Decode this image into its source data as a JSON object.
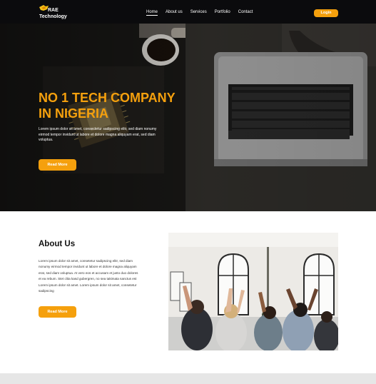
{
  "brand": {
    "line1": "RAE",
    "line2": "Technology"
  },
  "nav": {
    "links": [
      "Home",
      "About us",
      "Services",
      "Portfolio",
      "Contact"
    ],
    "active_index": 0,
    "login_label": "Login"
  },
  "hero": {
    "title_line1": "NO 1 TECH COMPANY",
    "title_line2": "IN NIGERIA",
    "text": "Lorem ipsum dolor sit amet, consectetur sadipscing elitr, sed diam nonumy eirmod tempor invidunt ut labore et dolore magna aliquyam erat, sed diam voluptua.",
    "button_label": "Read More",
    "slides_total": 4,
    "active_slide": 1
  },
  "about": {
    "title": "About Us",
    "text": "Lorem ipsum dolor sit amet, consetetur sadipscing elitr, sed diam nonumy eirmod tempor invidunt ut labore et dolore magna aliquyam erat, sed diam voluptua. At vero eos et accusam et justo duo dolores et ea rebum. Stet clita kasd gubergren, no sea takimata sanctus est Lorem ipsum dolor sit amet. Lorem ipsum dolor sit amet, consetetur sadipscing",
    "button_label": "Read More"
  },
  "colors": {
    "accent": "#f5a00d",
    "nav_bg": "#0b0b0d"
  }
}
